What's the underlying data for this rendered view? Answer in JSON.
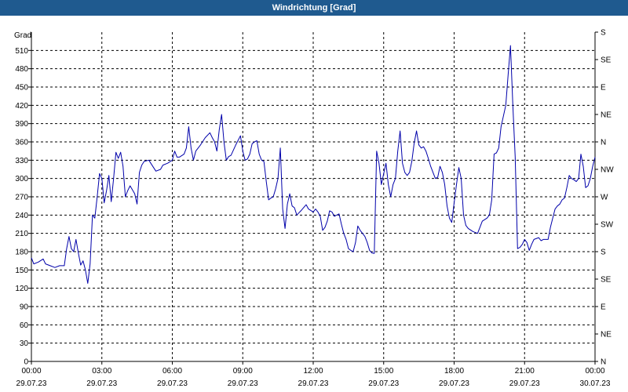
{
  "window": {
    "title": "Windrichtung [Grad]"
  },
  "colors": {
    "title_bar": "#1f5a8f",
    "series": "#0000aa",
    "grid": "#000000"
  },
  "chart_data": {
    "type": "line",
    "title": "Windrichtung [Grad]",
    "ylabel": "Grad",
    "ylim": [
      0,
      540
    ],
    "yticks": [
      0,
      30,
      60,
      90,
      120,
      150,
      180,
      210,
      240,
      270,
      300,
      330,
      360,
      390,
      420,
      450,
      480,
      510
    ],
    "xlim": [
      0,
      24
    ],
    "xticks": [
      {
        "value": 0,
        "time": "00:00",
        "date": "29.07.23"
      },
      {
        "value": 3,
        "time": "03:00",
        "date": "29.07.23"
      },
      {
        "value": 6,
        "time": "06:00",
        "date": "29.07.23"
      },
      {
        "value": 9,
        "time": "09:00",
        "date": "29.07.23"
      },
      {
        "value": 12,
        "time": "12:00",
        "date": "29.07.23"
      },
      {
        "value": 15,
        "time": "15:00",
        "date": "29.07.23"
      },
      {
        "value": 18,
        "time": "18:00",
        "date": "29.07.23"
      },
      {
        "value": 21,
        "time": "21:00",
        "date": "29.07.23"
      },
      {
        "value": 24,
        "time": "00:00",
        "date": "30.07.23"
      }
    ],
    "right_axis": [
      {
        "label": "S",
        "value": 540
      },
      {
        "label": "SE",
        "value": 495
      },
      {
        "label": "E",
        "value": 450
      },
      {
        "label": "NE",
        "value": 405
      },
      {
        "label": "N",
        "value": 360
      },
      {
        "label": "NW",
        "value": 315
      },
      {
        "label": "W",
        "value": 270
      },
      {
        "label": "SW",
        "value": 225
      },
      {
        "label": "S",
        "value": 180
      },
      {
        "label": "SE",
        "value": 135
      },
      {
        "label": "E",
        "value": 90
      },
      {
        "label": "NE",
        "value": 45
      },
      {
        "label": "N",
        "value": 0
      }
    ],
    "grid": true,
    "series": [
      {
        "values": [
          [
            0.0,
            170
          ],
          [
            0.1,
            160
          ],
          [
            0.3,
            163
          ],
          [
            0.5,
            168
          ],
          [
            0.6,
            160
          ],
          [
            0.8,
            157
          ],
          [
            1.0,
            154
          ],
          [
            1.2,
            157
          ],
          [
            1.4,
            157
          ],
          [
            1.5,
            185
          ],
          [
            1.6,
            205
          ],
          [
            1.7,
            185
          ],
          [
            1.8,
            180
          ],
          [
            1.9,
            200
          ],
          [
            2.0,
            178
          ],
          [
            2.1,
            158
          ],
          [
            2.2,
            165
          ],
          [
            2.3,
            150
          ],
          [
            2.4,
            128
          ],
          [
            2.5,
            160
          ],
          [
            2.6,
            240
          ],
          [
            2.7,
            235
          ],
          [
            2.8,
            270
          ],
          [
            2.9,
            308
          ],
          [
            3.0,
            300
          ],
          [
            3.1,
            260
          ],
          [
            3.2,
            280
          ],
          [
            3.3,
            305
          ],
          [
            3.4,
            262
          ],
          [
            3.5,
            300
          ],
          [
            3.6,
            343
          ],
          [
            3.7,
            333
          ],
          [
            3.8,
            343
          ],
          [
            3.9,
            320
          ],
          [
            4.0,
            270
          ],
          [
            4.1,
            280
          ],
          [
            4.2,
            288
          ],
          [
            4.4,
            275
          ],
          [
            4.5,
            258
          ],
          [
            4.6,
            310
          ],
          [
            4.7,
            322
          ],
          [
            4.8,
            328
          ],
          [
            5.0,
            330
          ],
          [
            5.2,
            318
          ],
          [
            5.3,
            312
          ],
          [
            5.5,
            315
          ],
          [
            5.6,
            322
          ],
          [
            5.8,
            325
          ],
          [
            6.0,
            330
          ],
          [
            6.1,
            345
          ],
          [
            6.2,
            335
          ],
          [
            6.3,
            335
          ],
          [
            6.5,
            340
          ],
          [
            6.6,
            350
          ],
          [
            6.7,
            385
          ],
          [
            6.8,
            350
          ],
          [
            6.9,
            330
          ],
          [
            7.0,
            345
          ],
          [
            7.2,
            355
          ],
          [
            7.4,
            367
          ],
          [
            7.6,
            375
          ],
          [
            7.7,
            367
          ],
          [
            7.8,
            360
          ],
          [
            7.9,
            345
          ],
          [
            8.0,
            380
          ],
          [
            8.1,
            405
          ],
          [
            8.2,
            360
          ],
          [
            8.3,
            330
          ],
          [
            8.4,
            336
          ],
          [
            8.5,
            338
          ],
          [
            8.7,
            355
          ],
          [
            8.9,
            370
          ],
          [
            9.0,
            345
          ],
          [
            9.1,
            330
          ],
          [
            9.2,
            332
          ],
          [
            9.3,
            340
          ],
          [
            9.4,
            357
          ],
          [
            9.5,
            360
          ],
          [
            9.6,
            362
          ],
          [
            9.7,
            340
          ],
          [
            9.8,
            330
          ],
          [
            9.9,
            328
          ],
          [
            10.0,
            295
          ],
          [
            10.1,
            265
          ],
          [
            10.2,
            268
          ],
          [
            10.3,
            270
          ],
          [
            10.4,
            283
          ],
          [
            10.5,
            300
          ],
          [
            10.6,
            350
          ],
          [
            10.7,
            250
          ],
          [
            10.8,
            218
          ],
          [
            10.9,
            258
          ],
          [
            11.0,
            275
          ],
          [
            11.1,
            255
          ],
          [
            11.2,
            252
          ],
          [
            11.3,
            240
          ],
          [
            11.5,
            248
          ],
          [
            11.7,
            257
          ],
          [
            11.8,
            250
          ],
          [
            12.0,
            245
          ],
          [
            12.1,
            250
          ],
          [
            12.2,
            245
          ],
          [
            12.3,
            238
          ],
          [
            12.4,
            215
          ],
          [
            12.5,
            220
          ],
          [
            12.6,
            230
          ],
          [
            12.7,
            247
          ],
          [
            12.8,
            245
          ],
          [
            12.9,
            238
          ],
          [
            13.0,
            240
          ],
          [
            13.1,
            242
          ],
          [
            13.2,
            225
          ],
          [
            13.3,
            210
          ],
          [
            13.4,
            200
          ],
          [
            13.5,
            185
          ],
          [
            13.6,
            182
          ],
          [
            13.7,
            180
          ],
          [
            13.8,
            195
          ],
          [
            13.9,
            222
          ],
          [
            14.0,
            215
          ],
          [
            14.1,
            210
          ],
          [
            14.2,
            205
          ],
          [
            14.3,
            195
          ],
          [
            14.4,
            182
          ],
          [
            14.5,
            178
          ],
          [
            14.6,
            177
          ],
          [
            14.7,
            345
          ],
          [
            14.8,
            325
          ],
          [
            14.9,
            290
          ],
          [
            15.0,
            308
          ],
          [
            15.1,
            325
          ],
          [
            15.2,
            290
          ],
          [
            15.3,
            270
          ],
          [
            15.4,
            290
          ],
          [
            15.5,
            300
          ],
          [
            15.6,
            345
          ],
          [
            15.7,
            378
          ],
          [
            15.8,
            325
          ],
          [
            15.9,
            310
          ],
          [
            16.0,
            305
          ],
          [
            16.1,
            310
          ],
          [
            16.2,
            328
          ],
          [
            16.3,
            358
          ],
          [
            16.4,
            378
          ],
          [
            16.5,
            355
          ],
          [
            16.6,
            350
          ],
          [
            16.7,
            352
          ],
          [
            16.8,
            345
          ],
          [
            16.9,
            333
          ],
          [
            17.0,
            320
          ],
          [
            17.1,
            310
          ],
          [
            17.2,
            300
          ],
          [
            17.3,
            302
          ],
          [
            17.4,
            320
          ],
          [
            17.5,
            310
          ],
          [
            17.6,
            290
          ],
          [
            17.7,
            255
          ],
          [
            17.8,
            235
          ],
          [
            17.9,
            228
          ],
          [
            18.0,
            260
          ],
          [
            18.1,
            290
          ],
          [
            18.2,
            318
          ],
          [
            18.3,
            300
          ],
          [
            18.4,
            240
          ],
          [
            18.5,
            223
          ],
          [
            18.6,
            218
          ],
          [
            18.8,
            213
          ],
          [
            19.0,
            210
          ],
          [
            19.2,
            230
          ],
          [
            19.4,
            235
          ],
          [
            19.5,
            240
          ],
          [
            19.6,
            265
          ],
          [
            19.7,
            340
          ],
          [
            19.8,
            342
          ],
          [
            19.9,
            350
          ],
          [
            20.0,
            385
          ],
          [
            20.2,
            420
          ],
          [
            20.3,
            470
          ],
          [
            20.4,
            518
          ],
          [
            20.5,
            420
          ],
          [
            20.6,
            335
          ],
          [
            20.7,
            185
          ],
          [
            20.8,
            187
          ],
          [
            20.9,
            192
          ],
          [
            21.0,
            200
          ],
          [
            21.1,
            195
          ],
          [
            21.2,
            182
          ],
          [
            21.3,
            192
          ],
          [
            21.4,
            200
          ],
          [
            21.6,
            203
          ],
          [
            21.7,
            198
          ],
          [
            21.8,
            200
          ],
          [
            22.0,
            200
          ],
          [
            22.1,
            220
          ],
          [
            22.2,
            235
          ],
          [
            22.3,
            250
          ],
          [
            22.4,
            255
          ],
          [
            22.5,
            258
          ],
          [
            22.6,
            265
          ],
          [
            22.7,
            268
          ],
          [
            22.8,
            285
          ],
          [
            22.9,
            305
          ],
          [
            23.0,
            300
          ],
          [
            23.1,
            298
          ],
          [
            23.2,
            295
          ],
          [
            23.3,
            300
          ],
          [
            23.4,
            340
          ],
          [
            23.5,
            320
          ],
          [
            23.6,
            285
          ],
          [
            23.7,
            288
          ],
          [
            23.8,
            300
          ],
          [
            23.9,
            320
          ],
          [
            24.0,
            335
          ]
        ]
      }
    ]
  }
}
